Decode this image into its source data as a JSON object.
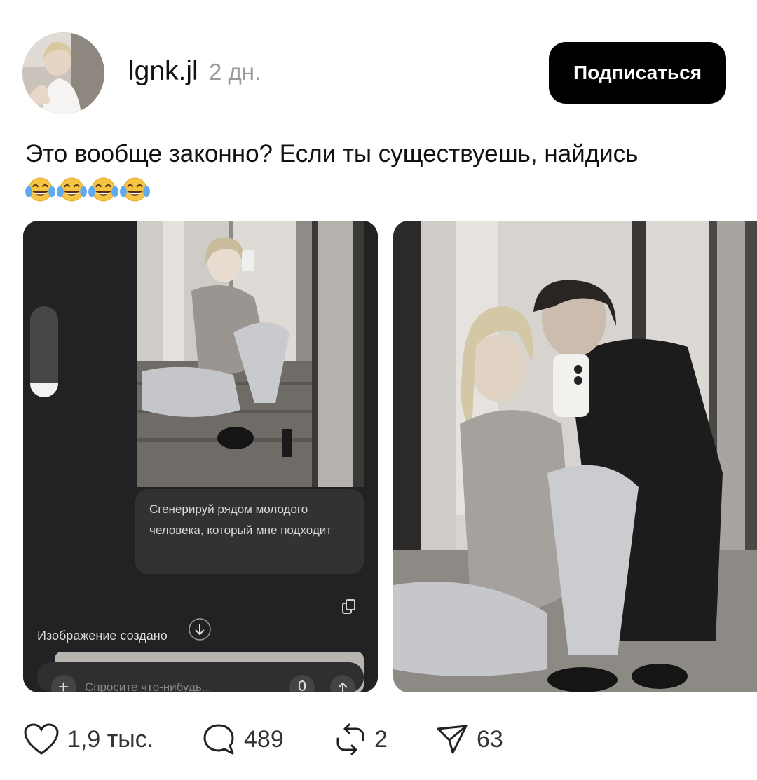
{
  "post": {
    "username": "lgnk.jl",
    "time": "2 дн.",
    "follow_label": "Подписаться",
    "text": "Это вообще законно? Если ты существуешь, найдись",
    "emojis": [
      "face-with-tears-of-joy",
      "face-with-tears-of-joy",
      "face-with-tears-of-joy",
      "face-with-tears-of-joy"
    ]
  },
  "media": [
    {
      "kind": "chat-screenshot",
      "prompt_text": "Сгенерируй рядом молодого человека, который мне подходит",
      "caption": "Изображение создано",
      "input_placeholder": "Спросите что-нибудь..."
    },
    {
      "kind": "photo"
    }
  ],
  "actions": {
    "likes": "1,9 тыс.",
    "comments": "489",
    "reposts": "2",
    "shares": "63"
  },
  "colors": {
    "button_bg": "#000000",
    "button_text": "#ffffff",
    "muted": "#9a9a9a",
    "chat_bg": "#222224"
  }
}
